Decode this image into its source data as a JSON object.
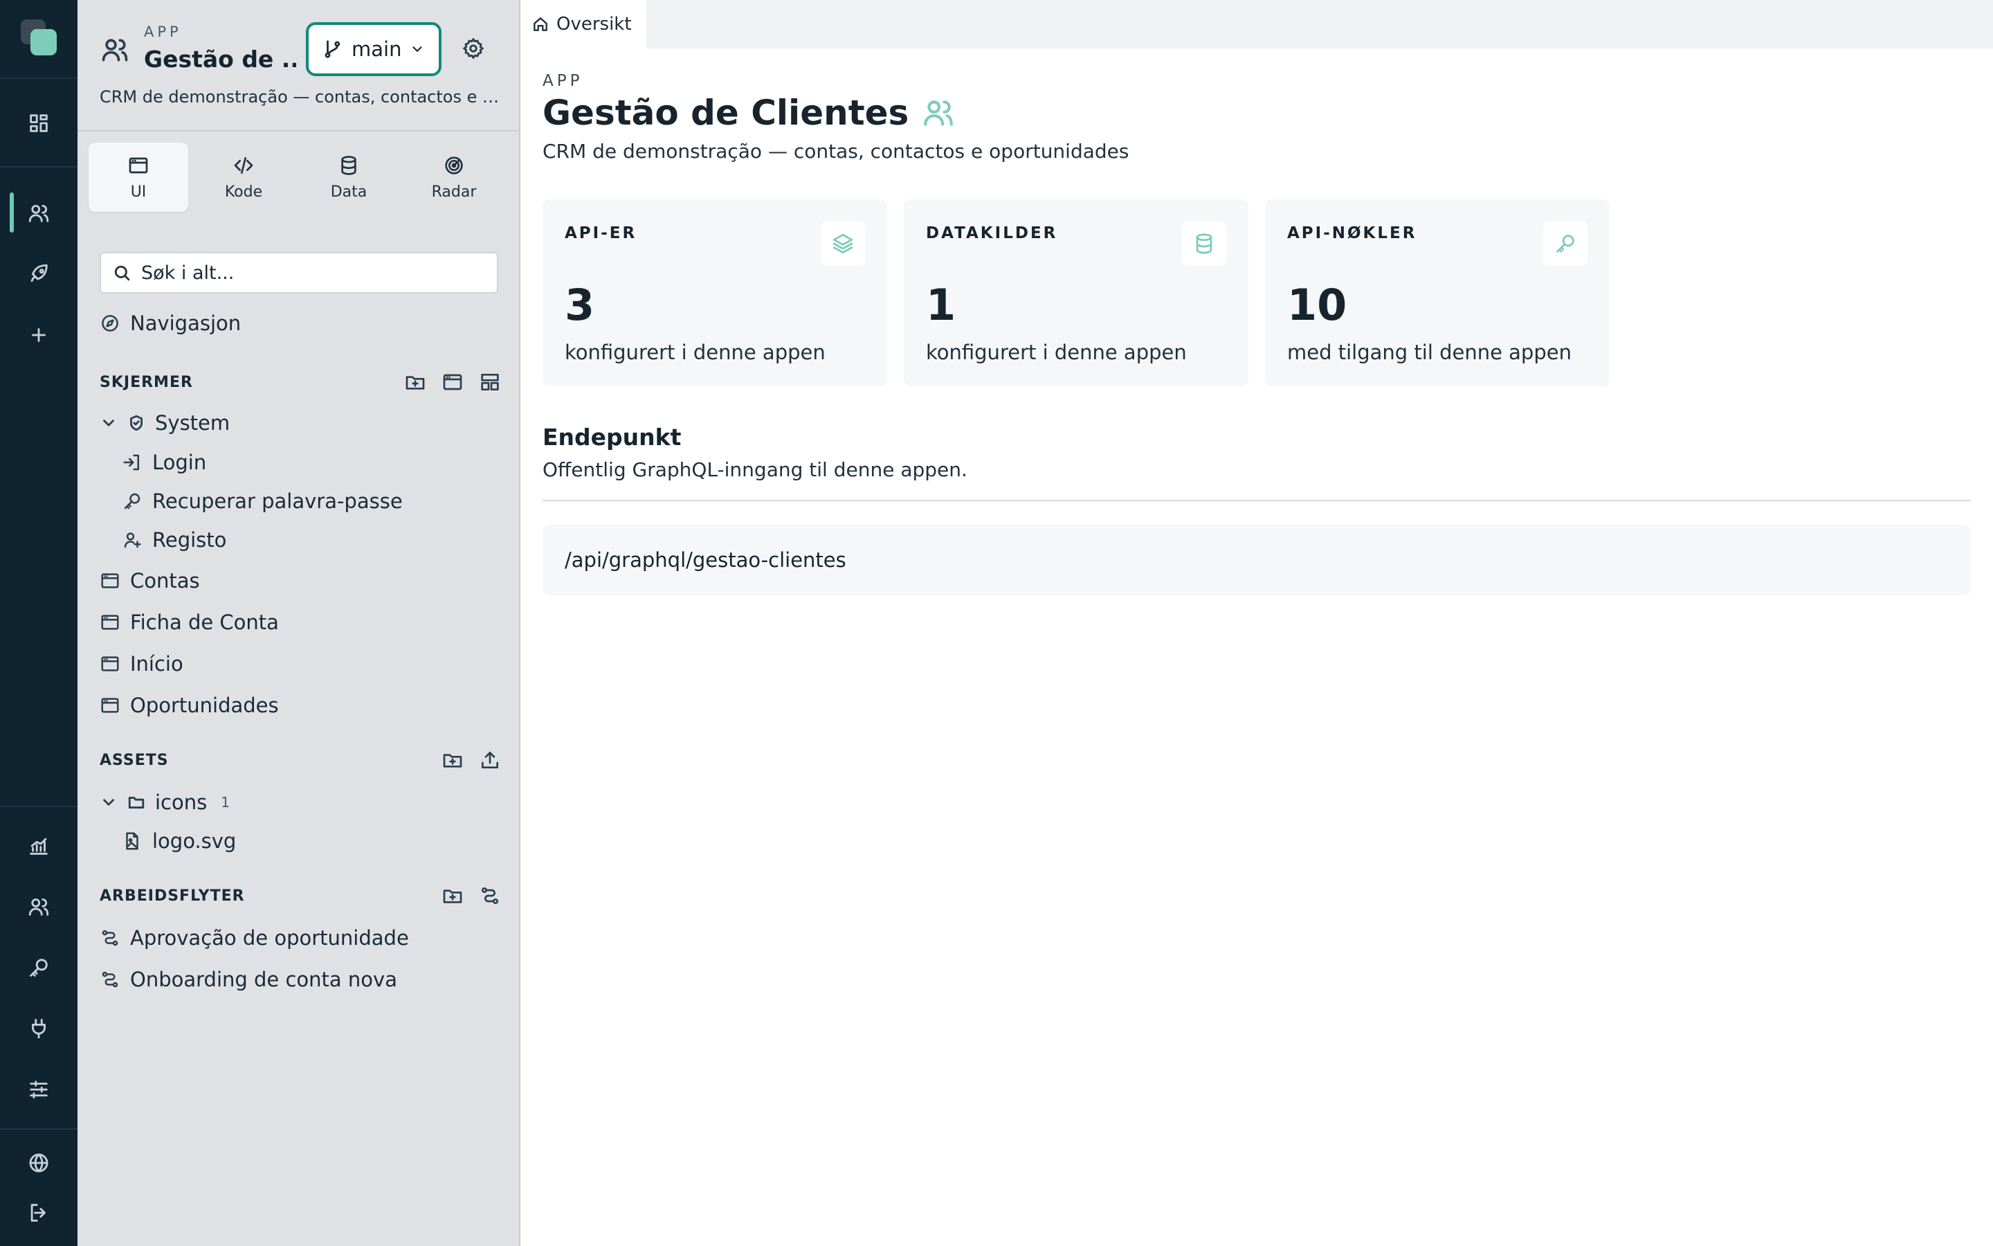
{
  "rail": {
    "items": [
      {
        "name": "dashboard-icon"
      },
      {
        "name": "users-icon",
        "active": true
      },
      {
        "name": "rocket-icon"
      },
      {
        "name": "plus-icon"
      },
      {
        "name": "analytics-icon"
      },
      {
        "name": "team-icon"
      },
      {
        "name": "key-icon"
      },
      {
        "name": "plug-icon"
      },
      {
        "name": "sliders-icon"
      },
      {
        "name": "globe-icon"
      },
      {
        "name": "logout-icon"
      }
    ],
    "accent_color": "#6fc9b6"
  },
  "sidebar": {
    "app_kicker": "APP",
    "app_name": "Gestão de ...",
    "branch": "main",
    "app_desc": "CRM de demonstração — contas, contactos e o...",
    "mode_tabs": [
      {
        "label": "UI",
        "icon": "browser-window-icon",
        "active": true
      },
      {
        "label": "Kode",
        "icon": "code-icon"
      },
      {
        "label": "Data",
        "icon": "database-icon"
      },
      {
        "label": "Radar",
        "icon": "radar-icon"
      }
    ],
    "search_placeholder": "Søk i alt...",
    "navigation_label": "Navigasjon",
    "screens": {
      "title": "SKJERMER",
      "system_folder": "System",
      "system_children": [
        "Login",
        "Recuperar palavra-passe",
        "Registo"
      ],
      "items": [
        "Contas",
        "Ficha de Conta",
        "Início",
        "Oportunidades"
      ]
    },
    "assets": {
      "title": "ASSETS",
      "folder": "icons",
      "folder_count": "1",
      "files": [
        "logo.svg"
      ]
    },
    "workflows": {
      "title": "ARBEIDSFLYTER",
      "items": [
        "Aprovação de oportunidade",
        "Onboarding de conta nova"
      ]
    }
  },
  "main": {
    "tab_label": "Oversikt",
    "kicker": "APP",
    "title": "Gestão de Clientes",
    "description": "CRM de demonstração — contas, contactos e oportunidades",
    "cards": [
      {
        "title": "API-ER",
        "value": "3",
        "sub": "konfigurert i denne appen",
        "icon": "layers-icon"
      },
      {
        "title": "DATAKILDER",
        "value": "1",
        "sub": "konfigurert i denne appen",
        "icon": "database-icon"
      },
      {
        "title": "API-NØKLER",
        "value": "10",
        "sub": "med tilgang til denne appen",
        "icon": "key-icon"
      }
    ],
    "endpoint": {
      "title": "Endepunkt",
      "description": "Offentlig GraphQL-inngang til denne appen.",
      "url": "/api/graphql/gestao-clientes"
    },
    "accent_color": "#7ecdb8",
    "focus_color": "#11897a"
  }
}
